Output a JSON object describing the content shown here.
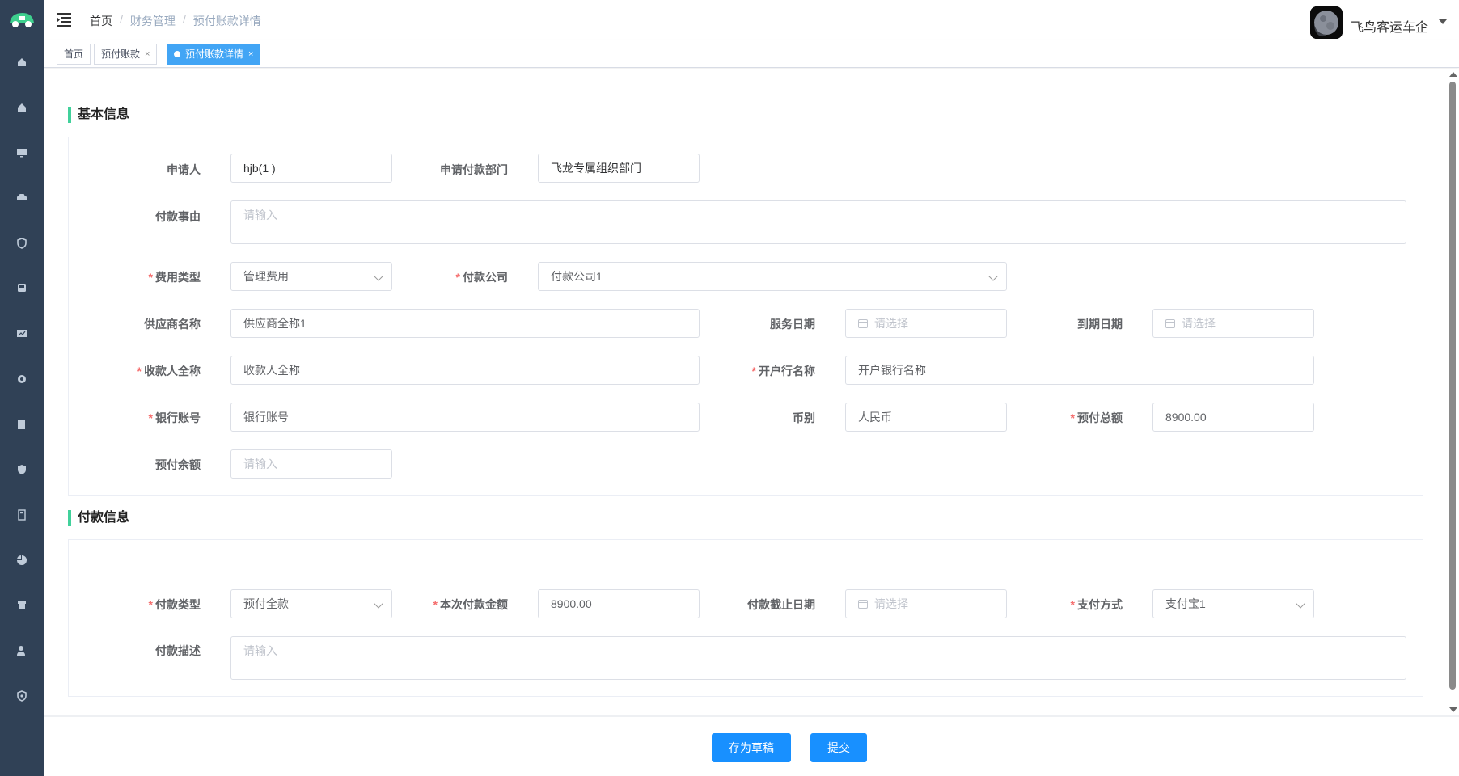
{
  "colors": {
    "sidebar": "#304156",
    "accent": "#1890ff",
    "section_bar": "#41d19b",
    "required": "#f56c6c"
  },
  "sidebar": {
    "icons": [
      "home-icon",
      "home-icon",
      "monitor-icon",
      "car-icon",
      "shield-icon",
      "bus-icon",
      "chart-icon",
      "gear-icon",
      "clipboard-icon",
      "security-icon",
      "document-icon",
      "pie-chart-icon",
      "archive-icon",
      "user-icon",
      "shield-check-icon"
    ]
  },
  "header": {
    "breadcrumb": [
      "首页",
      "财务管理",
      "预付账款详情"
    ],
    "company": "飞鸟客运车企"
  },
  "tags": [
    {
      "label": "首页"
    },
    {
      "label": "预付账款",
      "close": "×"
    },
    {
      "label": "预付账款详情",
      "close": "×"
    }
  ],
  "basic": {
    "title": "基本信息",
    "applicant": {
      "label": "申请人",
      "value": "hjb(1              )"
    },
    "department": {
      "label": "申请付款部门",
      "value": "飞龙专属组织部门"
    },
    "reason": {
      "label": "付款事由",
      "placeholder": "请输入"
    },
    "expense_type": {
      "label": "费用类型",
      "value": "管理费用"
    },
    "pay_company": {
      "label": "付款公司",
      "value": "付款公司1"
    },
    "supplier": {
      "label": "供应商名称",
      "value": "供应商全称1"
    },
    "service_date": {
      "label": "服务日期",
      "placeholder": "请选择"
    },
    "due_date": {
      "label": "到期日期",
      "placeholder": "请选择"
    },
    "payee": {
      "label": "收款人全称",
      "value": "收款人全称"
    },
    "bank": {
      "label": "开户行名称",
      "value": "开户银行名称"
    },
    "account": {
      "label": "银行账号",
      "value": "银行账号"
    },
    "currency": {
      "label": "币别",
      "value": "人民币"
    },
    "total": {
      "label": "预付总额",
      "value": "8900.00"
    },
    "balance": {
      "label": "预付余额",
      "placeholder": "请输入"
    }
  },
  "payment": {
    "title": "付款信息",
    "pay_type": {
      "label": "付款类型",
      "value": "预付全款"
    },
    "amount": {
      "label": "本次付款金额",
      "value": "8900.00"
    },
    "deadline": {
      "label": "付款截止日期",
      "placeholder": "请选择"
    },
    "method": {
      "label": "支付方式",
      "value": "支付宝1"
    },
    "desc": {
      "label": "付款描述",
      "placeholder": "请输入"
    }
  },
  "footer": {
    "draft": "存为草稿",
    "submit": "提交"
  }
}
